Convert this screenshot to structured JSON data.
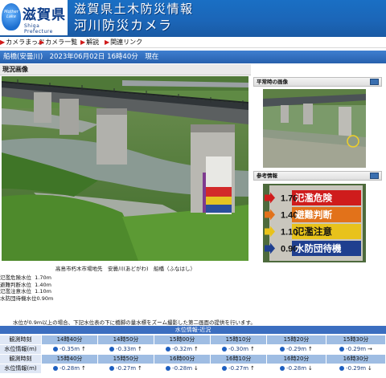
{
  "header": {
    "lake_text": "Mother Lake",
    "pref_kanji": "滋賀県",
    "pref_en": "Shiga Prefecture",
    "title_line1": "滋賀県土木防災情報",
    "title_line2": "河川防災カメラ"
  },
  "nav": {
    "items": [
      "カメラまっぷ",
      "カメラ一覧",
      "解説",
      "関連リンク"
    ]
  },
  "station_bar": "船橋(安曇川)　2023年06月02日 16時40分　現在",
  "section_current": "現況画像",
  "camera": {
    "caption": "高島市朽木市場地先　安曇川(あどがわ)　船橋（ふなはし）",
    "level_labels": [
      "氾濫危険水位",
      "避難判断水位",
      "氾濫注意水位",
      "水防団待機水位"
    ],
    "level_values": [
      "1.70m",
      "1.40m",
      "1.10m",
      "0.90m"
    ],
    "note": "水位が0.9m以上の場合、下記水位表の下に橋脚の量水標をズーム撮影した第二画面の提供を行います。"
  },
  "side": {
    "normal_title": "平常時の画像",
    "ref_title": "参考情報",
    "gauge_values": [
      "1.70",
      "1.40",
      "1.10",
      "0.90"
    ],
    "gauge_labels": [
      "氾濫危険",
      "避難判断",
      "氾濫注意",
      "水防団待機"
    ],
    "gauge_colors": [
      "#cf1c1c",
      "#e2721a",
      "#e8c21b",
      "#1f3f8f"
    ]
  },
  "table": {
    "title": "水位情報-近況",
    "row_labels": [
      "観測時刻",
      "水位情報(m)",
      "観測時刻",
      "水位情報(m)"
    ],
    "times_row1": [
      "14時40分",
      "14時50分",
      "15時00分",
      "15時10分",
      "15時20分",
      "15時30分"
    ],
    "values_row1": [
      "-0.35m",
      "-0.33m",
      "-0.32m",
      "-0.30m",
      "-0.29m",
      "-0.29m"
    ],
    "arrows_row1": [
      "↑",
      "↑",
      "↑",
      "↑",
      "↑",
      "→"
    ],
    "times_row2": [
      "15時40分",
      "15時50分",
      "16時00分",
      "16時10分",
      "16時20分",
      "16時30分"
    ],
    "values_row2": [
      "-0.28m",
      "-0.27m",
      "-0.28m",
      "-0.27m",
      "-0.28m",
      "-0.29m"
    ],
    "arrows_row2": [
      "↑",
      "↑",
      "↓",
      "↑",
      "↓",
      "↓"
    ]
  },
  "colors": {
    "header_blue": "#1b66b8",
    "bar_blue": "#2d68b5",
    "time_cell": "#9fbde3",
    "value_text": "#1a3f80"
  }
}
